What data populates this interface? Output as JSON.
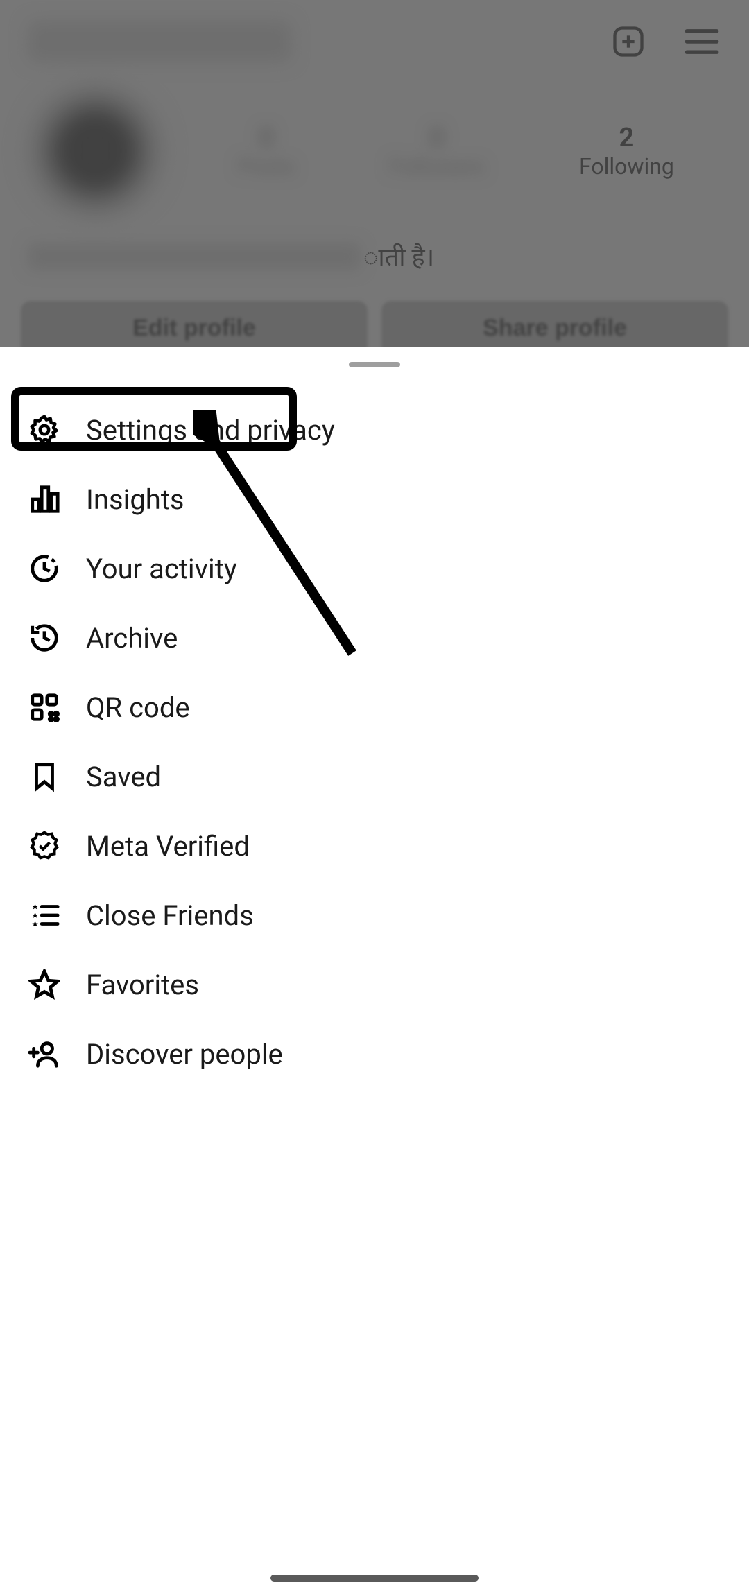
{
  "header": {
    "create_icon": "plus-square",
    "menu_icon": "hamburger"
  },
  "stats": {
    "posts_label": "Posts",
    "followers_label": "Followers",
    "following_count": "2",
    "following_label": "Following"
  },
  "bio": {
    "visible_text": "ाती है।"
  },
  "buttons": {
    "edit_profile": "Edit profile",
    "share_profile": "Share profile"
  },
  "menu": {
    "items": [
      {
        "id": "settings",
        "label": "Settings and privacy",
        "icon": "gear"
      },
      {
        "id": "insights",
        "label": "Insights",
        "icon": "bar-chart"
      },
      {
        "id": "activity",
        "label": "Your activity",
        "icon": "clock-history"
      },
      {
        "id": "archive",
        "label": "Archive",
        "icon": "archive"
      },
      {
        "id": "qrcode",
        "label": "QR code",
        "icon": "qr"
      },
      {
        "id": "saved",
        "label": "Saved",
        "icon": "bookmark"
      },
      {
        "id": "verified",
        "label": "Meta Verified",
        "icon": "verified-badge"
      },
      {
        "id": "closefriends",
        "label": "Close Friends",
        "icon": "list-star"
      },
      {
        "id": "favorites",
        "label": "Favorites",
        "icon": "star"
      },
      {
        "id": "discover",
        "label": "Discover people",
        "icon": "person-plus"
      }
    ]
  }
}
